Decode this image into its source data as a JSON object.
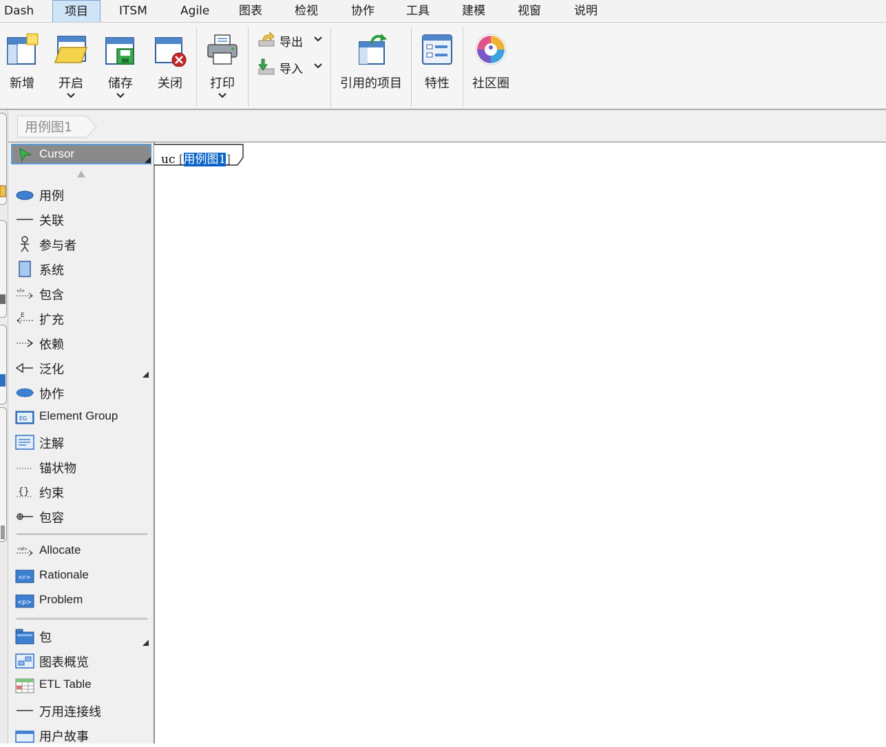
{
  "menu": {
    "tabs": [
      {
        "label": "Dash"
      },
      {
        "label": "项目"
      },
      {
        "label": "ITSM"
      },
      {
        "label": "Agile"
      },
      {
        "label": "图表"
      },
      {
        "label": "检视"
      },
      {
        "label": "协作"
      },
      {
        "label": "工具"
      },
      {
        "label": "建模"
      },
      {
        "label": "视窗"
      },
      {
        "label": "说明"
      }
    ],
    "active_tab": "项目"
  },
  "ribbon": {
    "new_label": "新增",
    "open_label": "开启",
    "save_label": "储存",
    "close_label": "关闭",
    "print_label": "打印",
    "export_label": "导出",
    "import_label": "导入",
    "referenced_projects_label": "引用的项目",
    "properties_label": "特性",
    "community_label": "社区圈"
  },
  "breadcrumb": {
    "item": "用例图1"
  },
  "toolbox": {
    "cursor_label": "Cursor",
    "group1": [
      {
        "label": "用例",
        "icon": "use-case-ellipse-icon"
      },
      {
        "label": "关联",
        "icon": "association-line-icon"
      },
      {
        "label": "参与者",
        "icon": "actor-stick-figure-icon"
      },
      {
        "label": "系统",
        "icon": "system-boundary-icon"
      },
      {
        "label": "包含",
        "icon": "include-arrow-icon"
      },
      {
        "label": "扩充",
        "icon": "extend-arrow-icon"
      },
      {
        "label": "依赖",
        "icon": "dependency-arrow-icon"
      },
      {
        "label": "泛化",
        "icon": "generalization-arrow-icon"
      },
      {
        "label": "协作",
        "icon": "collaboration-ellipse-icon"
      },
      {
        "label": "Element Group",
        "icon": "element-group-icon"
      },
      {
        "label": "注解",
        "icon": "note-icon"
      },
      {
        "label": "锚状物",
        "icon": "anchor-dotted-line-icon"
      },
      {
        "label": "约束",
        "icon": "constraint-braces-icon"
      },
      {
        "label": "包容",
        "icon": "containment-icon"
      }
    ],
    "group2": [
      {
        "label": "Allocate",
        "icon": "allocate-icon"
      },
      {
        "label": "Rationale",
        "icon": "rationale-icon"
      },
      {
        "label": "Problem",
        "icon": "problem-icon"
      }
    ],
    "group3": [
      {
        "label": "包",
        "icon": "package-folder-icon"
      },
      {
        "label": "图表概览",
        "icon": "diagram-overview-icon"
      },
      {
        "label": "ETL Table",
        "icon": "etl-table-icon"
      },
      {
        "label": "万用连接线",
        "icon": "generic-connector-icon"
      },
      {
        "label": "用户故事",
        "icon": "user-story-icon"
      }
    ]
  },
  "canvas": {
    "frame_kind": "uc",
    "frame_name": "用例图1"
  },
  "colors": {
    "accent_blue": "#0a64c8",
    "active_tab_bg": "#cfe4f7",
    "toolbox_bg": "#f0f0f0",
    "cursor_bg": "#8a8a8a"
  }
}
